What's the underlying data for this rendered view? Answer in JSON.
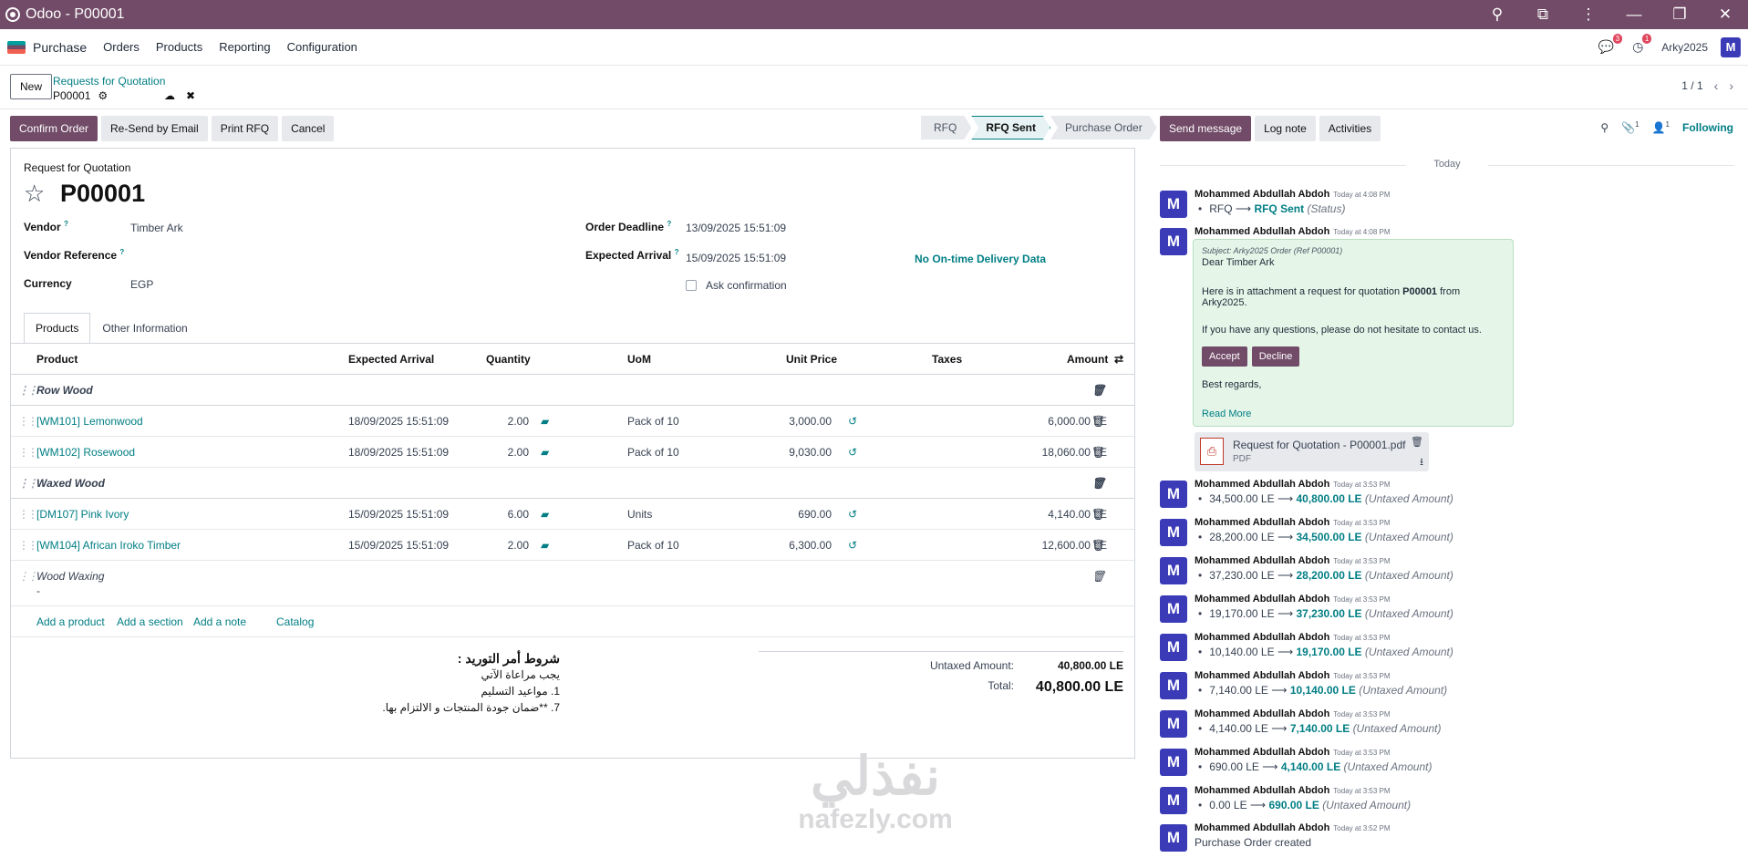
{
  "window": {
    "title": "Odoo - P00001"
  },
  "nav": {
    "app": "Purchase",
    "items": [
      "Orders",
      "Products",
      "Reporting",
      "Configuration"
    ],
    "messages_badge": "3",
    "activities_badge": "1",
    "company": "Arky2025",
    "avatar": "M"
  },
  "control": {
    "new_label": "New",
    "breadcrumb_parent": "Requests for Quotation",
    "record": "P00001",
    "pager": "1 / 1"
  },
  "actions": {
    "confirm": "Confirm Order",
    "resend": "Re-Send by Email",
    "print": "Print RFQ",
    "cancel": "Cancel"
  },
  "stages": {
    "items": [
      "RFQ",
      "RFQ Sent",
      "Purchase Order"
    ],
    "active": "RFQ Sent"
  },
  "form": {
    "type_label": "Request for Quotation",
    "name": "P00001",
    "vendor_label": "Vendor",
    "vendor": "Timber Ark",
    "vendor_ref_label": "Vendor Reference",
    "vendor_ref": "",
    "currency_label": "Currency",
    "currency": "EGP",
    "deadline_label": "Order Deadline",
    "deadline": "13/09/2025 15:51:09",
    "arrival_label": "Expected Arrival",
    "arrival": "15/09/2025 15:51:09",
    "ontime": "No On-time Delivery Data",
    "ask_confirmation": "Ask confirmation",
    "help_mark": "?"
  },
  "tabs": [
    "Products",
    "Other Information"
  ],
  "columns": {
    "product": "Product",
    "arrival": "Expected Arrival",
    "qty": "Quantity",
    "uom": "UoM",
    "price": "Unit Price",
    "taxes": "Taxes",
    "amount": "Amount"
  },
  "lines": [
    {
      "kind": "section",
      "name": "Row Wood"
    },
    {
      "kind": "product",
      "name": "[WM101] Lemonwood",
      "arrival": "18/09/2025 15:51:09",
      "qty": "2.00",
      "uom": "Pack of 10",
      "price": "3,000.00",
      "amount": "6,000.00 LE"
    },
    {
      "kind": "product",
      "name": "[WM102] Rosewood",
      "arrival": "18/09/2025 15:51:09",
      "qty": "2.00",
      "uom": "Pack of 10",
      "price": "9,030.00",
      "amount": "18,060.00 LE"
    },
    {
      "kind": "section",
      "name": "Waxed Wood"
    },
    {
      "kind": "product",
      "name": "[DM107] Pink Ivory",
      "arrival": "15/09/2025 15:51:09",
      "qty": "6.00",
      "uom": "Units",
      "price": "690.00",
      "amount": "4,140.00 LE"
    },
    {
      "kind": "product",
      "name": "[WM104] African Iroko Timber",
      "arrival": "15/09/2025 15:51:09",
      "qty": "2.00",
      "uom": "Pack of 10",
      "price": "6,300.00",
      "amount": "12,600.00 LE"
    },
    {
      "kind": "note",
      "name": "Wood Waxing",
      "sub": "-"
    }
  ],
  "add": {
    "product": "Add a product",
    "section": "Add a section",
    "note": "Add a note",
    "catalog": "Catalog"
  },
  "terms": {
    "title": "شروط أمر التوريد :",
    "l1": "يجب مراعاة الآتي",
    "l2": "1. مواعيد التسليم",
    "l3": "7. **ضمان جودة المنتجات و الالتزام بها."
  },
  "totals": {
    "untaxed_label": "Untaxed Amount:",
    "untaxed": "40,800.00 LE",
    "total_label": "Total:",
    "total": "40,800.00 LE"
  },
  "chatter": {
    "send": "Send message",
    "log": "Log note",
    "activities": "Activities",
    "attach_count": "1",
    "follower_count": "1",
    "following": "Following",
    "today": "Today",
    "author": "Mohammed Abdullah Abdoh",
    "avatar": "M",
    "m1": {
      "time": "Today at 4:08 PM",
      "old": "RFQ",
      "new": "RFQ Sent",
      "field": "(Status)"
    },
    "m2": {
      "time": "Today at 4:08 PM"
    },
    "mail": {
      "subject": "Subject: Arky2025 Order (Ref P00001)",
      "greet": "Dear Timber Ark",
      "l1a": "Here is in attachment a request for quotation ",
      "l1b": "P00001",
      "l1c": " from Arky2025.",
      "l2": "If you have any questions, please do not hesitate to contact us.",
      "accept": "Accept",
      "decline": "Decline",
      "regards": "Best regards,",
      "more": "Read More"
    },
    "attachment": {
      "name": "Request for Quotation - P00001.pdf",
      "type": "PDF"
    },
    "changes": [
      {
        "time": "Today at 3:53 PM",
        "old": "34,500.00 LE",
        "new": "40,800.00 LE",
        "field": "(Untaxed Amount)"
      },
      {
        "time": "Today at 3:53 PM",
        "old": "28,200.00 LE",
        "new": "34,500.00 LE",
        "field": "(Untaxed Amount)"
      },
      {
        "time": "Today at 3:53 PM",
        "old": "37,230.00 LE",
        "new": "28,200.00 LE",
        "field": "(Untaxed Amount)"
      },
      {
        "time": "Today at 3:53 PM",
        "old": "19,170.00 LE",
        "new": "37,230.00 LE",
        "field": "(Untaxed Amount)"
      },
      {
        "time": "Today at 3:53 PM",
        "old": "10,140.00 LE",
        "new": "19,170.00 LE",
        "field": "(Untaxed Amount)"
      },
      {
        "time": "Today at 3:53 PM",
        "old": "7,140.00 LE",
        "new": "10,140.00 LE",
        "field": "(Untaxed Amount)"
      },
      {
        "time": "Today at 3:53 PM",
        "old": "4,140.00 LE",
        "new": "7,140.00 LE",
        "field": "(Untaxed Amount)"
      },
      {
        "time": "Today at 3:53 PM",
        "old": "690.00 LE",
        "new": "4,140.00 LE",
        "field": "(Untaxed Amount)"
      },
      {
        "time": "Today at 3:53 PM",
        "old": "0.00 LE",
        "new": "690.00 LE",
        "field": "(Untaxed Amount)"
      }
    ],
    "created": {
      "time": "Today at 3:52 PM",
      "text": "Purchase Order created"
    }
  },
  "watermark": {
    "arabic": "نفذلي",
    "latin": "nafezly.com"
  }
}
